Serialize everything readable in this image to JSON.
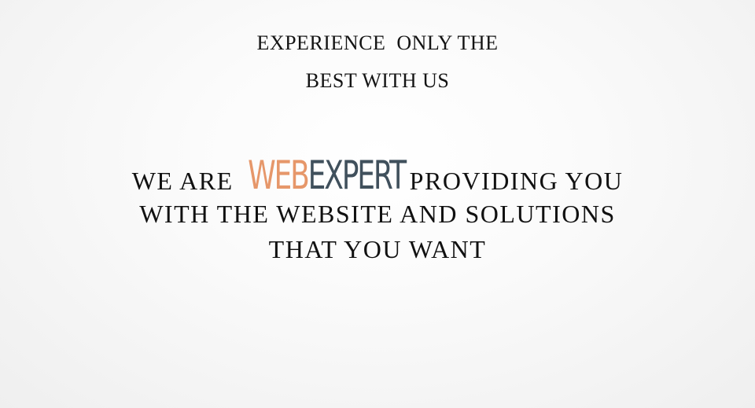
{
  "tagline": {
    "line1": "EXPERIENCE  ONLY THE",
    "line2": "BEST WITH US"
  },
  "hero": {
    "prefix": "WE ARE",
    "brand": {
      "part1": "WEB",
      "part2": "EXPERT",
      "part1_color": "#e6976a",
      "part2_color": "#40505c"
    },
    "suffix": "PROVIDING YOU",
    "line2": "WITH THE WEBSITE AND SOLUTIONS",
    "line3": "THAT YOU WANT"
  }
}
